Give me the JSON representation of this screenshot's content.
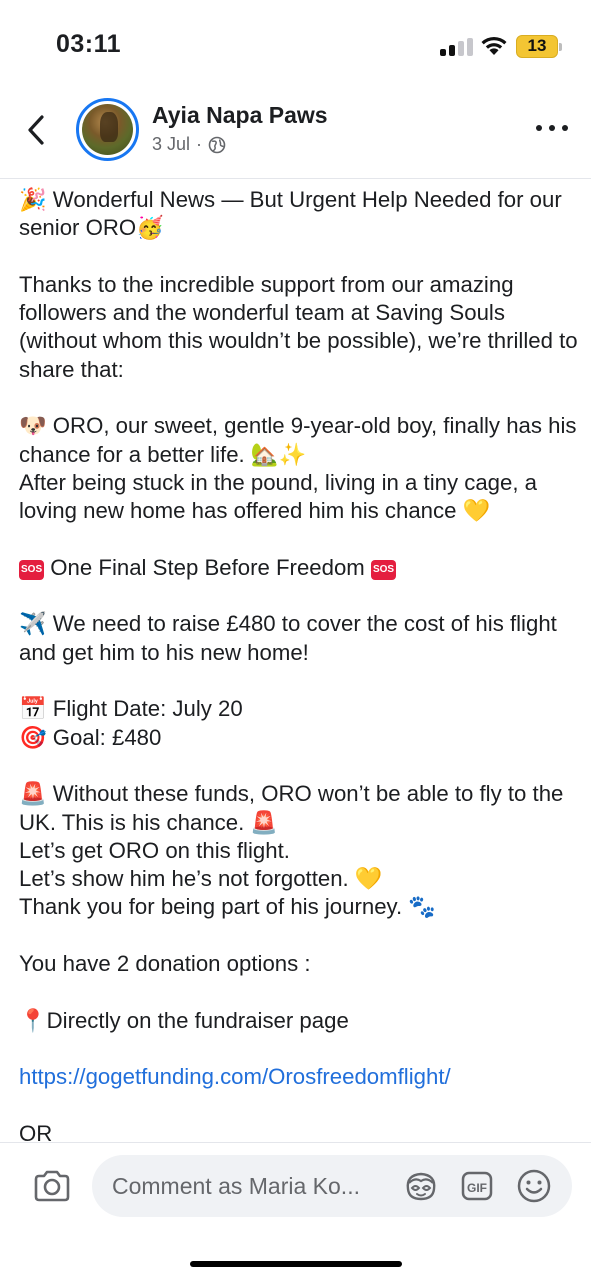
{
  "status_bar": {
    "time": "03:11",
    "battery": "13",
    "battery_color": "#f3c533"
  },
  "header": {
    "page_name": "Ayia Napa Paws",
    "date": "3 Jul",
    "separator": "·",
    "privacy_icon": "globe-icon",
    "back_icon": "chevron-left-icon",
    "more_icon": "more-horizontal-icon"
  },
  "post": {
    "line_01": "🎉 Wonderful News — But Urgent Help Needed for our senior ORO🥳",
    "line_02": "Thanks to the incredible support from our amazing followers and the wonderful team at Saving Souls (without whom this wouldn’t be possible), we’re thrilled to share that:",
    "line_03": "🐶 ORO, our sweet, gentle 9-year-old boy, finally has his chance for a better life. 🏡✨",
    "line_04": "After being stuck in the pound, living in a tiny cage, a loving new home has offered him his chance 💛",
    "sos_badge": "SOS",
    "line_05": "One Final Step Before Freedom",
    "line_06": "✈️ We need to raise £480 to cover the cost of his flight and get him to his new home!",
    "line_07": "📅 Flight Date: July 20",
    "line_08": "🎯 Goal: £480",
    "line_09": "🚨 Without these funds, ORO won’t be able to fly to the UK. This is his chance. 🚨",
    "line_10": "Let’s get ORO on this flight.",
    "line_11": "Let’s show him he’s not forgotten. 💛",
    "line_12": "Thank you for being part of his journey. 🐾",
    "line_13": "You have 2 donation options :",
    "line_14": "📍Directly on the fundraiser page",
    "link": "https://gogetfunding.com/Orosfreedomflight/",
    "line_15": "OR"
  },
  "comment_bar": {
    "placeholder": "Comment as Maria Ko...",
    "camera_icon": "camera-icon",
    "avatar_icon": "avatar-sticker-icon",
    "gif_label": "GIF",
    "emoji_icon": "smiley-icon"
  }
}
